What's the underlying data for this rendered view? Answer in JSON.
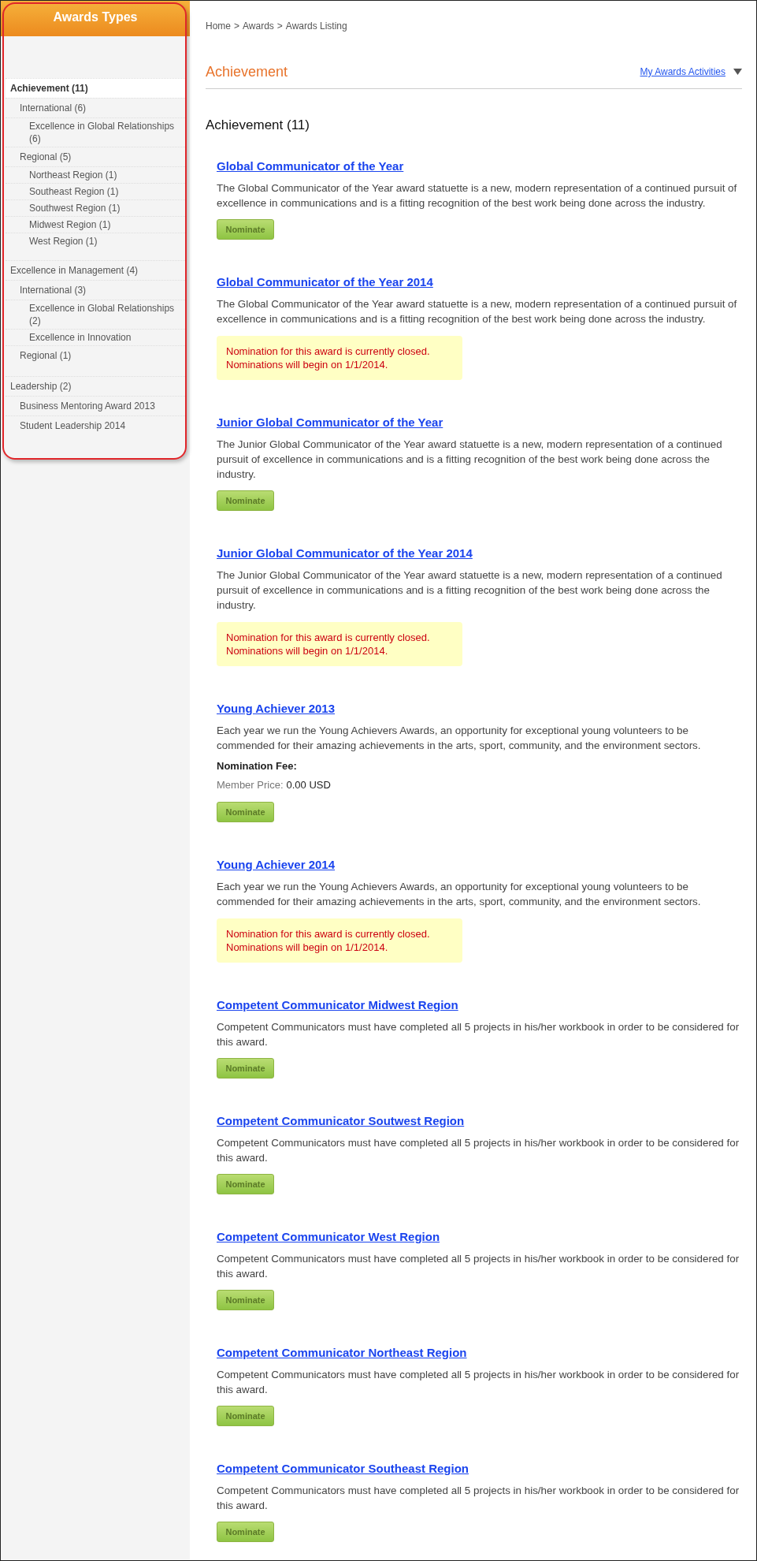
{
  "sidebar": {
    "title": "Awards Types",
    "items": [
      {
        "label": "Achievement (11)",
        "selected": true,
        "children": [
          {
            "label": "International (6)",
            "selected": false,
            "children": [
              {
                "label": "Excellence in Global Relationships (6)",
                "selected": false
              }
            ]
          },
          {
            "label": "Regional (5)",
            "selected": false,
            "children": [
              {
                "label": "Northeast Region (1)",
                "selected": false
              },
              {
                "label": "Southeast Region (1)",
                "selected": false
              },
              {
                "label": "Southwest Region (1)",
                "selected": false
              },
              {
                "label": "Midwest Region (1)",
                "selected": false
              },
              {
                "label": "West Region (1)",
                "selected": false
              }
            ]
          }
        ]
      },
      {
        "label": "Excellence in Management (4)",
        "selected": false,
        "children": [
          {
            "label": "International (3)",
            "selected": false,
            "children": [
              {
                "label": "Excellence in Global Relationships (2)",
                "selected": false
              },
              {
                "label": "Excellence in Innovation",
                "selected": false
              }
            ]
          },
          {
            "label": "Regional (1)",
            "selected": false
          }
        ]
      },
      {
        "label": "Leadership (2)",
        "selected": false,
        "children": [
          {
            "label": "Business Mentoring Award 2013",
            "selected": false
          },
          {
            "label": "Student Leadership 2014",
            "selected": false
          }
        ]
      }
    ]
  },
  "breadcrumb": {
    "separator": ">",
    "items": [
      "Home",
      "Awards",
      "Awards Listing"
    ]
  },
  "page_title": "Achievement",
  "activities_link": "My Awards Activities",
  "section_heading": "Achievement (11)",
  "awards": [
    {
      "kind": "open",
      "title": "Global Communicator of the Year",
      "description": "The Global Communicator of the Year award statuette is a new, modern representation of a continued pursuit of excellence in communications and is a fitting recognition of the best work being done across the industry.",
      "button": "Nominate"
    },
    {
      "kind": "closed",
      "title": "Global Communicator of the Year 2014",
      "description": "The Global Communicator of the Year award statuette is a new, modern representation of a continued pursuit of excellence in communications and is a fitting recognition of the best work being done across the industry.",
      "notice": [
        "Nomination for this award is currently closed.",
        "Nominations will begin on 1/1/2014."
      ]
    },
    {
      "kind": "open",
      "title": "Junior Global Communicator of the Year",
      "description": "The Junior Global Communicator of the Year award statuette is a new, modern representation of a continued pursuit of excellence in communications and is a fitting recognition of the best work being done across the industry.",
      "button": "Nominate"
    },
    {
      "kind": "closed",
      "title": "Junior Global Communicator of the Year 2014",
      "description": "The Junior Global Communicator of the Year award statuette is a new, modern representation of a continued pursuit of excellence in communications and is a fitting recognition of the best work being done across the industry.",
      "notice": [
        "Nomination for this award is currently closed.",
        "Nominations will begin on 1/1/2014."
      ]
    },
    {
      "kind": "fee",
      "title": "Young Achiever 2013",
      "description": "Each year we run the Young Achievers Awards, an opportunity for exceptional young volunteers to be commended for their amazing achievements in the arts, sport, community, and the environment sectors.",
      "fee_heading": "Nomination Fee:",
      "price_label": "Member Price:",
      "price": "0.00 USD",
      "button": "Nominate"
    },
    {
      "kind": "closed",
      "title": "Young Achiever 2014",
      "description": "Each year we run the Young Achievers Awards, an opportunity for exceptional young volunteers to be commended for their amazing achievements in the arts, sport, community, and the environment sectors.",
      "notice": [
        "Nomination for this award is currently closed.",
        "Nominations will begin on 1/1/2014."
      ]
    },
    {
      "kind": "open",
      "title": "Competent Communicator Midwest Region",
      "description": "Competent Communicators must have completed all 5 projects in his/her workbook in order to be considered for this award.",
      "button": "Nominate"
    },
    {
      "kind": "open",
      "title": "Competent Communicator Soutwest Region",
      "description": "Competent Communicators must have completed all 5 projects in his/her workbook in order to be considered for this award.",
      "button": "Nominate"
    },
    {
      "kind": "open",
      "title": "Competent Communicator West Region",
      "description": "Competent Communicators must have completed all 5 projects in his/her workbook in order to be considered for this award.",
      "button": "Nominate"
    },
    {
      "kind": "open",
      "title": "Competent Communicator Northeast Region",
      "description": "Competent Communicators must have completed all 5 projects in his/her workbook in order to be considered for this award.",
      "button": "Nominate"
    },
    {
      "kind": "open",
      "title": "Competent Communicator Southeast Region",
      "description": "Competent Communicators must have completed all 5 projects in his/her workbook in order to be considered for this award.",
      "button": "Nominate"
    }
  ]
}
